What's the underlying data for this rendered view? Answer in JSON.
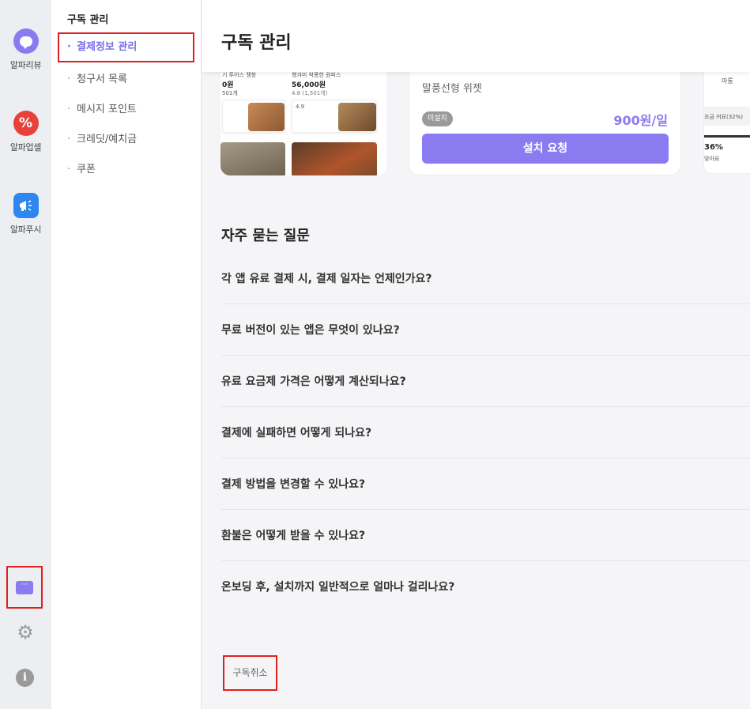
{
  "rail": {
    "items": [
      {
        "label": "알파리뷰",
        "icon": "chat-bubble-icon",
        "color": "#8a7cf0"
      },
      {
        "label": "알파업셀",
        "icon": "percent-badge-icon",
        "color": "#e8403a",
        "glyph": "%"
      },
      {
        "label": "알파푸시",
        "icon": "megaphone-icon",
        "color": "#2e86ee"
      }
    ],
    "bottom_icons": [
      "message-icon",
      "gear-icon",
      "info-icon"
    ]
  },
  "subnav": {
    "title": "구독 관리",
    "items": [
      {
        "label": "결제정보 관리",
        "active": true
      },
      {
        "label": "청구서 목록"
      },
      {
        "label": "메시지 포인트"
      },
      {
        "label": "크레딧/예치금"
      },
      {
        "label": "쿠폰"
      }
    ]
  },
  "header": {
    "title": "구독 관리"
  },
  "widget_card": {
    "name": "말풍선형 위젯",
    "status_badge": "미설치",
    "price": "900원/일",
    "button": "설치 요청"
  },
  "preview_card": {
    "texts": [
      "기 투어스 쟁창",
      "0원",
      "501개",
      "챙겨미 착몽한 원피스",
      "56,000원",
      "4.8 (1,501개)",
      "4.9"
    ]
  },
  "right_card": {
    "texts": [
      "마롱",
      "조금 커요(32%)",
      "36%",
      "맞아요"
    ]
  },
  "faq": {
    "title": "자주 묻는 질문",
    "items": [
      "각 앱 유료 결제 시, 결제 일자는 언제인가요?",
      "무료 버전이 있는 앱은 무엇이 있나요?",
      "유료 요금제 가격은 어떻게 계산되나요?",
      "결제에 실패하면 어떻게 되나요?",
      "결제 방법을 변경할 수 있나요?",
      "환불은 어떻게 받을 수 있나요?",
      "온보딩 후, 설치까지 일반적으로 얼마나 걸리나요?"
    ]
  },
  "cancel_label": "구독취소"
}
